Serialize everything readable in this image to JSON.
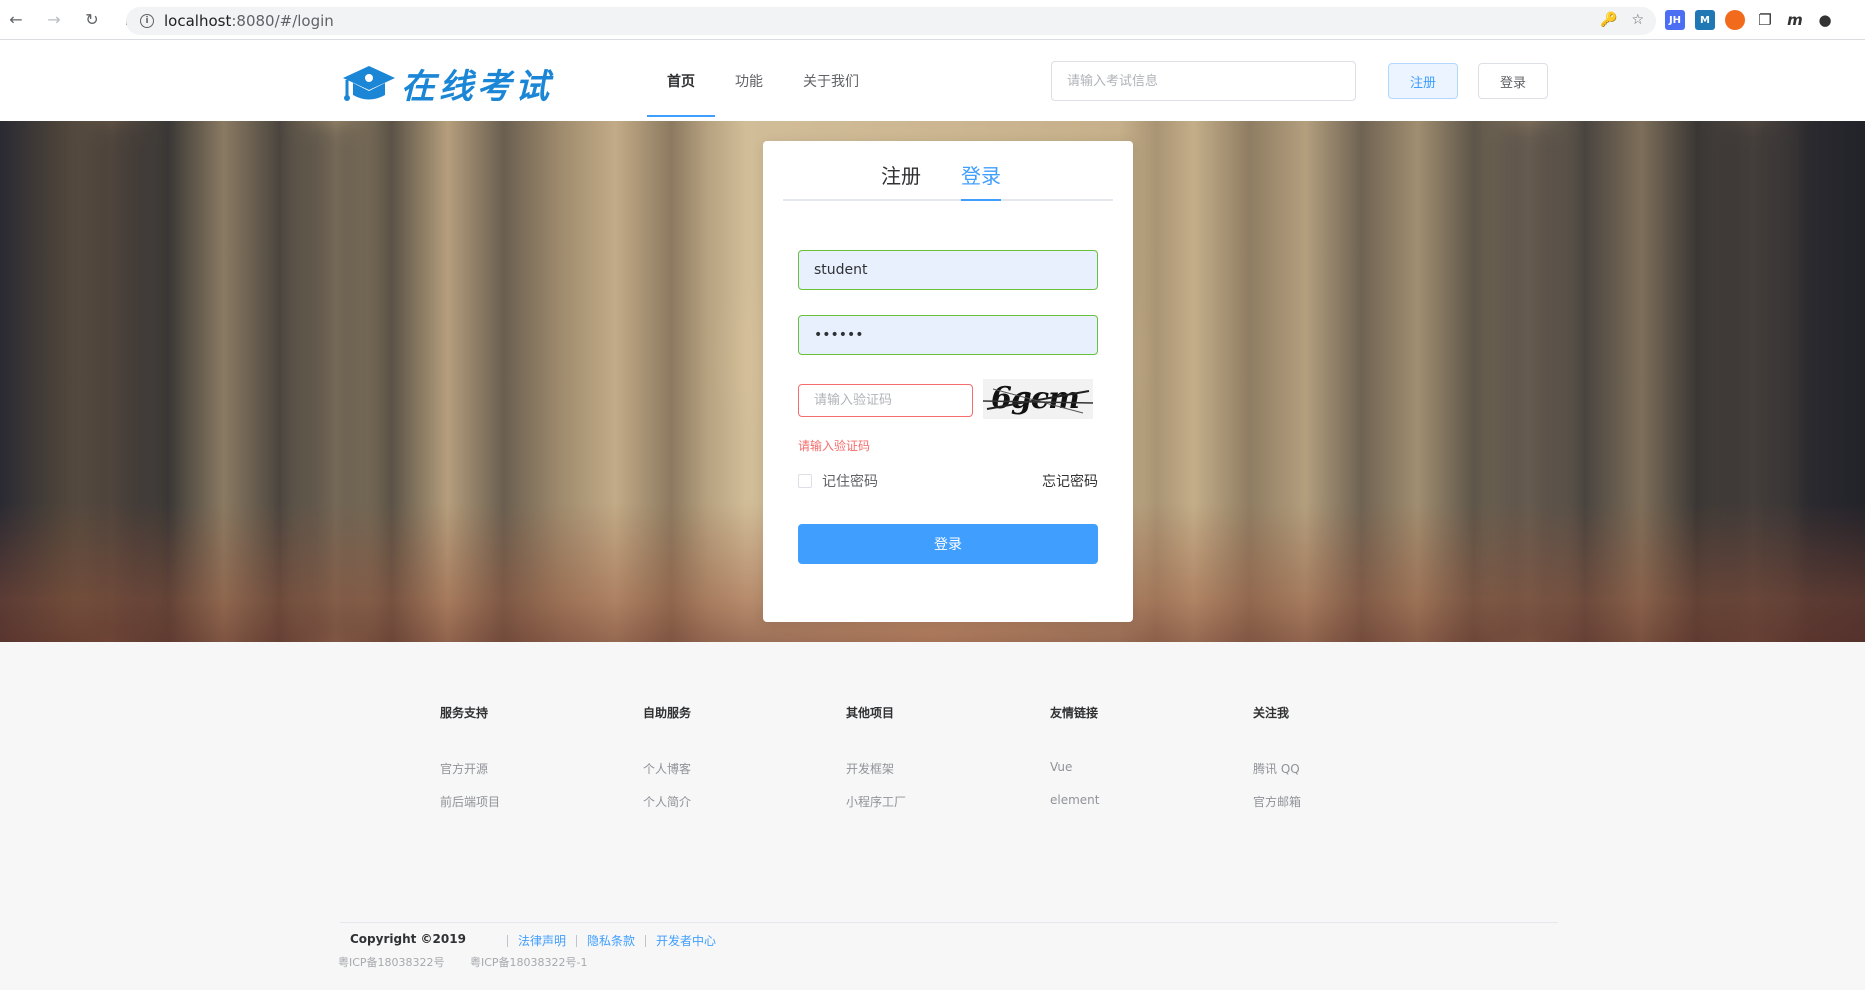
{
  "browser": {
    "url_host": "localhost",
    "url_path": ":8080/#/login",
    "extensions": [
      "JH",
      "M",
      "m"
    ]
  },
  "header": {
    "logo_text": "在线考试",
    "nav": [
      {
        "label": "首页"
      },
      {
        "label": "功能"
      },
      {
        "label": "关于我们"
      }
    ],
    "search_placeholder": "请输入考试信息",
    "register_label": "注册",
    "login_label": "登录"
  },
  "login_card": {
    "tabs": [
      {
        "label": "注册"
      },
      {
        "label": "登录"
      }
    ],
    "username_value": "student",
    "password_value": "••••••",
    "captcha_placeholder": "请输入验证码",
    "captcha_text": "6gcm",
    "captcha_error": "请输入验证码",
    "remember_label": "记住密码",
    "forgot_label": "忘记密码",
    "submit_label": "登录"
  },
  "footer": {
    "columns": [
      {
        "title": "服务支持",
        "links": [
          "官方开源",
          "前后端项目"
        ]
      },
      {
        "title": "自助服务",
        "links": [
          "个人博客",
          "个人简介"
        ]
      },
      {
        "title": "其他项目",
        "links": [
          "开发框架",
          "小程序工厂"
        ]
      },
      {
        "title": "友情链接",
        "links": [
          "Vue",
          "element"
        ]
      },
      {
        "title": "关注我",
        "links": [
          "腾讯 QQ",
          "官方邮箱"
        ]
      }
    ],
    "copyright": "Copyright ©2019",
    "legal_links": [
      "法律声明",
      "隐私条款",
      "开发者中心"
    ],
    "icp": [
      "粤ICP备18038322号",
      "粤ICP备18038322号-1"
    ]
  },
  "colors": {
    "primary": "#409eff",
    "success_border": "#67c23a",
    "error": "#f56c6c",
    "logo": "#1b86d6"
  }
}
